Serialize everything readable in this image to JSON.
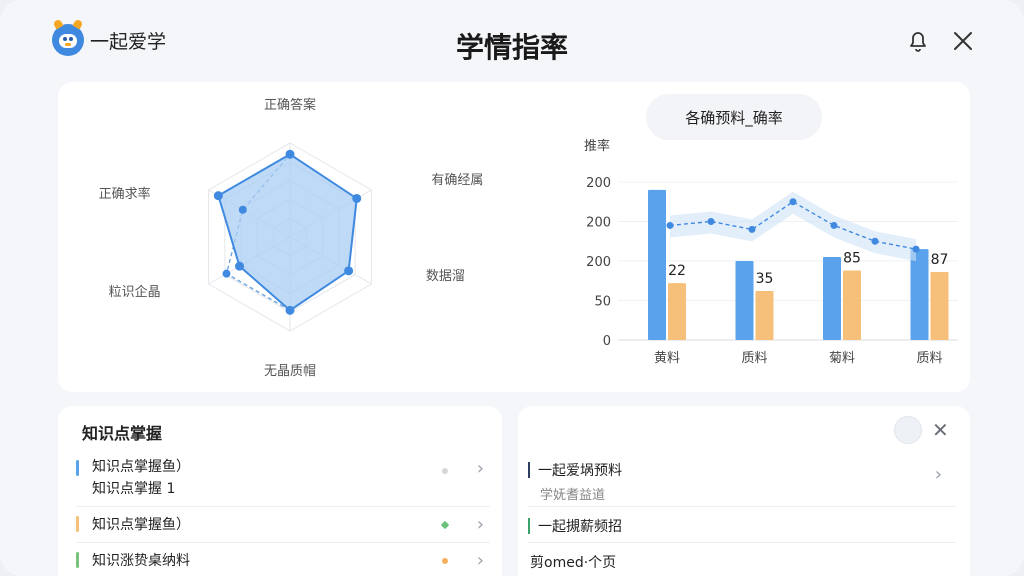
{
  "header": {
    "app_name": "一起爱学",
    "title": "学情指率"
  },
  "radar": {
    "labels": [
      "正确答案",
      "有确经属",
      "数据溜",
      "无晶质帽",
      "粒识企晶",
      "正确求率"
    ],
    "values": [
      0.88,
      0.82,
      0.72,
      0.78,
      0.62,
      0.88
    ],
    "dashed_values": [
      0.88,
      0.82,
      0.72,
      0.78,
      0.78,
      0.58
    ],
    "fill_color": "#a9cdf3",
    "line_color": "#3f8ae0"
  },
  "chart_data": {
    "type": "bar",
    "title": "各确预料_确率",
    "ylabel": "推率",
    "yticks": [
      "200",
      "200",
      "200",
      "50",
      "0"
    ],
    "ylim": [
      0,
      200
    ],
    "categories": [
      "黄料",
      "质料",
      "菊料",
      "质料"
    ],
    "series": [
      {
        "values": [
          190,
          100,
          105,
          115
        ],
        "color": "#5aa3ec"
      },
      {
        "values": [
          72,
          62,
          88,
          86
        ],
        "color": "#f7c07a"
      }
    ],
    "data_labels": [
      "22",
      "35",
      "85",
      "87"
    ],
    "line": {
      "values": [
        145,
        150,
        140,
        175,
        145,
        125,
        115
      ],
      "color": "#3f8ae0",
      "style": "dashed"
    }
  },
  "knowledge": {
    "title": "知识点掌握",
    "items": [
      {
        "line1": "知识点掌握鱼）",
        "line2": "知识点掌握 1",
        "bar_color": "#5aa3ec",
        "dot_color": "#d6d6d6"
      },
      {
        "line1": "知识点掌握鱼）",
        "line2": "",
        "bar_color": "#f7c07a",
        "dot_color": "#6ac27a"
      },
      {
        "line1": "知识涨贽桌纳料",
        "line2": "",
        "bar_color": "#7ac27a",
        "dot_color": "#f7b060"
      }
    ]
  },
  "right_panel": {
    "items": [
      {
        "line1": "一起爱埚预料",
        "line2": "学妩耆益道",
        "bar_color": "#2c3e60"
      },
      {
        "line1": "一起摫薪频招",
        "line2": "",
        "bar_color": "#3aa36a"
      },
      {
        "line1": "剪omed·个页",
        "line2": "",
        "bar_color": ""
      }
    ]
  }
}
